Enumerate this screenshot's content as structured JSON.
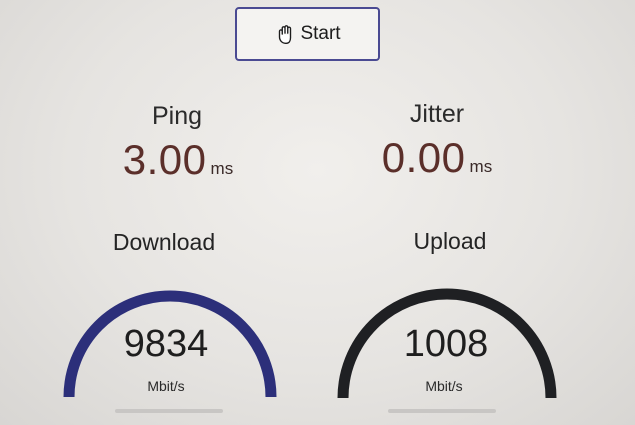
{
  "toolbar": {
    "start_label": "Start",
    "start_icon": "hand-pointer-icon"
  },
  "ping": {
    "title": "Ping",
    "value": "3.00",
    "unit": "ms"
  },
  "jitter": {
    "title": "Jitter",
    "value": "0.00",
    "unit": "ms"
  },
  "download": {
    "title": "Download",
    "value": "9834",
    "unit": "Mbit/s",
    "gauge_color": "#2c2f7a"
  },
  "upload": {
    "title": "Upload",
    "value": "1008",
    "unit": "Mbit/s",
    "gauge_color": "#1f2023"
  },
  "colors": {
    "accent": "#4a4a92",
    "metric_value": "#5b2f2a"
  }
}
